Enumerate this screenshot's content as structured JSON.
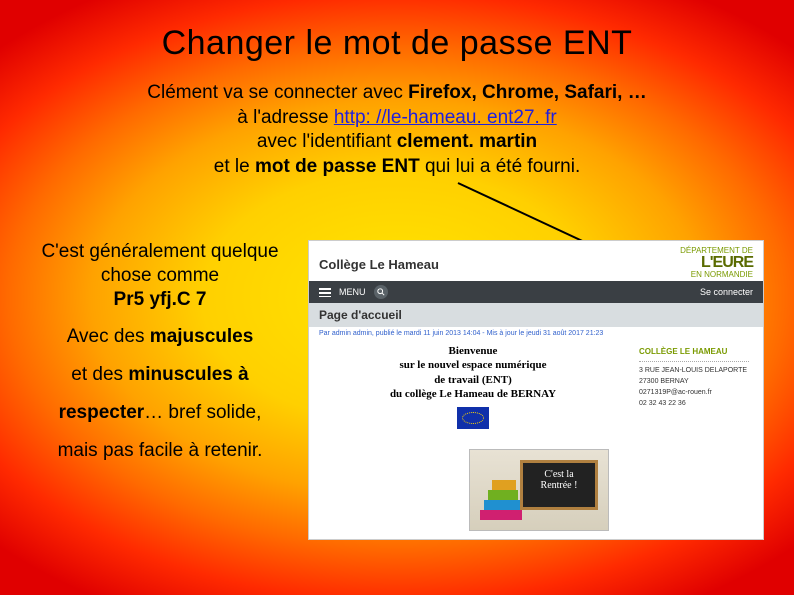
{
  "title": "Changer le mot de passe ENT",
  "intro": {
    "l1a": "Clément va se connecter avec ",
    "l1b": "Firefox, Chrome, Safari, …",
    "l2a": "à l'adresse ",
    "l2link": "http: //le-hameau. ent27. fr",
    "l3a": "avec l'identifiant ",
    "l3b": "clement. martin",
    "l4a": "et le ",
    "l4b": "mot de passe ENT",
    "l4c": " qui lui a été fourni."
  },
  "left": {
    "p1a": "C'est généralement quelque chose comme ",
    "p1b": "Pr5 yfj.C 7",
    "p2a": "Avec des ",
    "p2b": "majuscules",
    "p3a": "et des ",
    "p3b": "minuscules à",
    "p4a": "respecter",
    "p4b": "… bref solide,",
    "p5": "mais pas facile à retenir."
  },
  "screenshot": {
    "site_title": "Collège Le Hameau",
    "logo_small1": "DÉPARTEMENT DE",
    "logo_big": "L'EURE",
    "logo_small2": "EN NORMANDIE",
    "menu_label": "MENU",
    "login_label": "Se connecter",
    "page_accueil": "Page d'accueil",
    "meta": "Par admin admin, publié le mardi 11 juin 2013 14:04 - Mis à jour le jeudi 31 août 2017 21:23",
    "welcome": {
      "l1": "Bienvenue",
      "l2": "sur le nouvel espace numérique",
      "l3": "de travail (ENT)",
      "l4": "du collège Le Hameau de BERNAY"
    },
    "contact": {
      "hdr": "COLLÈGE LE HAMEAU",
      "addr1": "3 RUE JEAN-LOUIS DELAPORTE",
      "addr2": "27300 BERNAY",
      "email": "0271319P@ac-rouen.fr",
      "tel": "02 32 43 22 36"
    },
    "rentree1": "C'est la",
    "rentree2": "Rentrée !"
  }
}
